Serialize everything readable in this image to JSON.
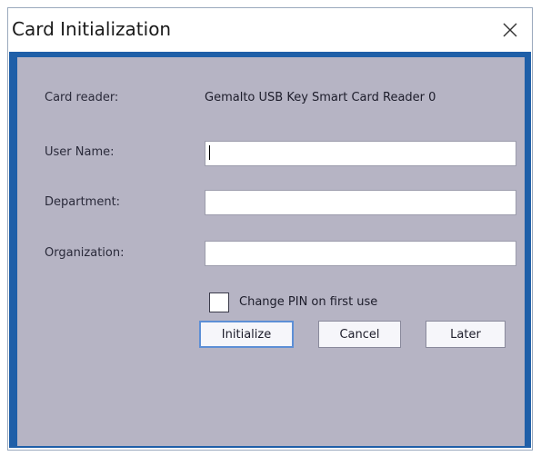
{
  "window": {
    "title": "Card Initialization"
  },
  "icons": {
    "close": "close-icon"
  },
  "form": {
    "card_reader_label": "Card reader:",
    "card_reader_value": "Gemalto USB Key Smart Card Reader 0",
    "user_name_label": "User Name:",
    "user_name_value": "",
    "department_label": "Department:",
    "department_value": "",
    "organization_label": "Organization:",
    "organization_value": "",
    "change_pin_label": "Change PIN on first use",
    "change_pin_checked": false
  },
  "buttons": {
    "initialize": "Initialize",
    "cancel": "Cancel",
    "later": "Later"
  },
  "colors": {
    "accent": "#1f5fa8",
    "panel": "#b6b4c4",
    "default_button_border": "#5d8fd6"
  }
}
